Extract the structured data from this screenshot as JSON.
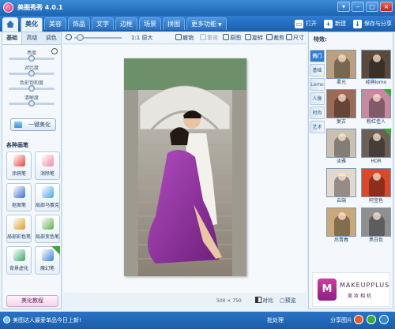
{
  "window": {
    "title": "美图秀秀 4.0.1",
    "controls": [
      "▾",
      "–",
      "□",
      "×"
    ]
  },
  "tabs": [
    {
      "label": "美化",
      "active": true
    },
    {
      "label": "美容"
    },
    {
      "label": "饰品"
    },
    {
      "label": "文字"
    },
    {
      "label": "边框"
    },
    {
      "label": "场景"
    },
    {
      "label": "拼图"
    },
    {
      "label": "更多功能",
      "dropdown": true
    }
  ],
  "top_actions": [
    {
      "label": "打开",
      "icon": "folder-icon"
    },
    {
      "label": "新建",
      "icon": "plus-icon"
    },
    {
      "label": "保存与分享",
      "icon": "save-icon"
    }
  ],
  "left_panel": {
    "subtabs": [
      "基础",
      "高级",
      "调色"
    ],
    "active_subtab": "基础",
    "sliders": [
      {
        "label": "亮度",
        "value": 0.5
      },
      {
        "label": "对比度",
        "value": 0.5
      },
      {
        "label": "色彩饱和度",
        "value": 0.5
      },
      {
        "label": "清晰度",
        "value": 0.5
      }
    ],
    "one_key_label": "一键美化",
    "brushes_title": "各种画笔",
    "brushes": [
      {
        "label": "涂鸦笔",
        "icon": "pencil-icon",
        "color": "#e2463b"
      },
      {
        "label": "消除笔",
        "icon": "eraser-icon",
        "color": "#f08aa6"
      },
      {
        "label": "抠图笔",
        "icon": "cutout-icon",
        "color": "#3a6fd1"
      },
      {
        "label": "局部马赛克",
        "icon": "mosaic-icon",
        "color": "#4aa3e8"
      },
      {
        "label": "局部彩色笔",
        "icon": "color-brush-icon",
        "color": "#d9a020"
      },
      {
        "label": "局部变色笔",
        "icon": "recolor-icon",
        "color": "#5bb24a"
      },
      {
        "label": "背景虚化",
        "icon": "blur-icon",
        "color": "#3aa86a"
      },
      {
        "label": "魔幻笔",
        "icon": "magic-pen-icon",
        "color": "#3f7fd9",
        "new": true
      }
    ],
    "tutorial_label": "美化教程"
  },
  "toolbar": {
    "zoom_level": 0.05,
    "items": [
      {
        "label": "原大",
        "prefix": "1:1",
        "dim": false
      },
      {
        "label": "撤销",
        "dim": false
      },
      {
        "label": "重做",
        "dim": true
      },
      {
        "label": "原图",
        "dim": false
      },
      {
        "label": "旋转",
        "dim": false
      },
      {
        "label": "裁剪",
        "dim": false
      },
      {
        "label": "尺寸",
        "dim": false
      }
    ]
  },
  "status": {
    "image_size": "500 × 750",
    "compare_label": "对比",
    "compare_prefix": "■",
    "fullscreen_label": "预览"
  },
  "right_panel": {
    "title": "特效:",
    "categories": [
      "热门",
      "基础",
      "Lomo",
      "人像",
      "时尚",
      "艺术"
    ],
    "active_category": "热门",
    "effects": [
      {
        "label": "柔光",
        "tint": "#b9a07e"
      },
      {
        "label": "经典lomo",
        "tint": "#5a4a3e"
      },
      {
        "label": "复古",
        "tint": "#9c6a55"
      },
      {
        "label": "粉红佳人",
        "tint": "#c58aa0",
        "new": true
      },
      {
        "label": "淡雅",
        "tint": "#c9c0b2"
      },
      {
        "label": "HDR",
        "tint": "#6d5f55",
        "new": true
      },
      {
        "label": "云端",
        "tint": "#e3d8cd"
      },
      {
        "label": "阿宝色",
        "tint": "#d8482c"
      },
      {
        "label": "后青春",
        "tint": "#c9a87a"
      },
      {
        "label": "黑白色",
        "tint": "#8f8f8f"
      }
    ],
    "ad": {
      "logo": "M",
      "brand": "MAKEUPPLUS",
      "subtitle": "美妆相机"
    }
  },
  "bottom_bar": {
    "tip": "美图达人最爱单品今日上新!",
    "batch_label": "批处理",
    "share_label": "分享图片"
  },
  "colors": {
    "accent": "#1d64b3",
    "dress": "#8e2a9a",
    "panel_bg": "#f4f8fc"
  }
}
